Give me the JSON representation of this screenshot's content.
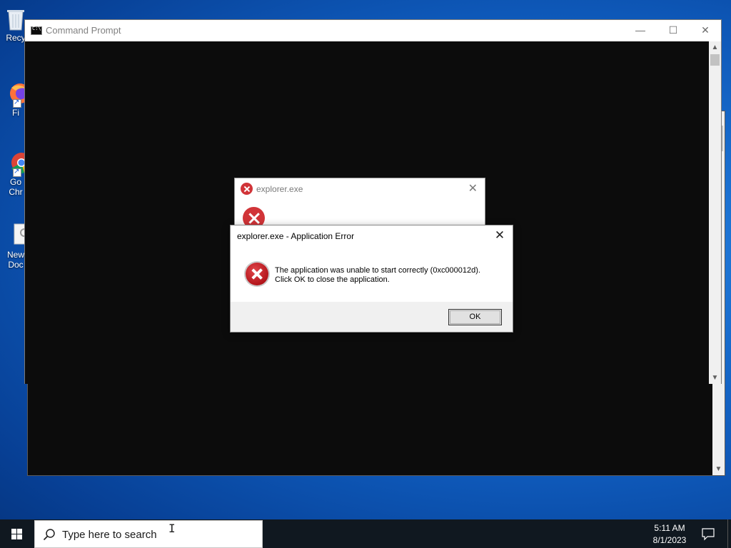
{
  "desktop": {
    "icons": [
      {
        "label": "Recy",
        "icon": "recycle-bin-icon"
      },
      {
        "label": "Fi",
        "icon": "firefox-icon"
      },
      {
        "label": "Go\nChr",
        "icon": "chrome-icon"
      },
      {
        "label": "New\nDoc",
        "icon": "document-icon"
      }
    ]
  },
  "cmd_window": {
    "title": "Command Prompt",
    "minimize_glyph": "—",
    "maximize_glyph": "☐",
    "close_glyph": "✕"
  },
  "bg_dialog": {
    "title": "explorer.exe",
    "close_glyph": "✕"
  },
  "error_dialog": {
    "title": "explorer.exe - Application Error",
    "message_line1": "The application was unable to start correctly (0xc000012d).",
    "message_line2": "Click OK to close the application.",
    "ok_label": "OK",
    "close_glyph": "✕"
  },
  "taskbar": {
    "search_placeholder": "Type here to search",
    "time": "5:11 AM",
    "date": "8/1/2023"
  },
  "colors": {
    "error_red": "#d13438",
    "taskbar_bg": "#101820",
    "console_bg": "#0c0c0c"
  }
}
